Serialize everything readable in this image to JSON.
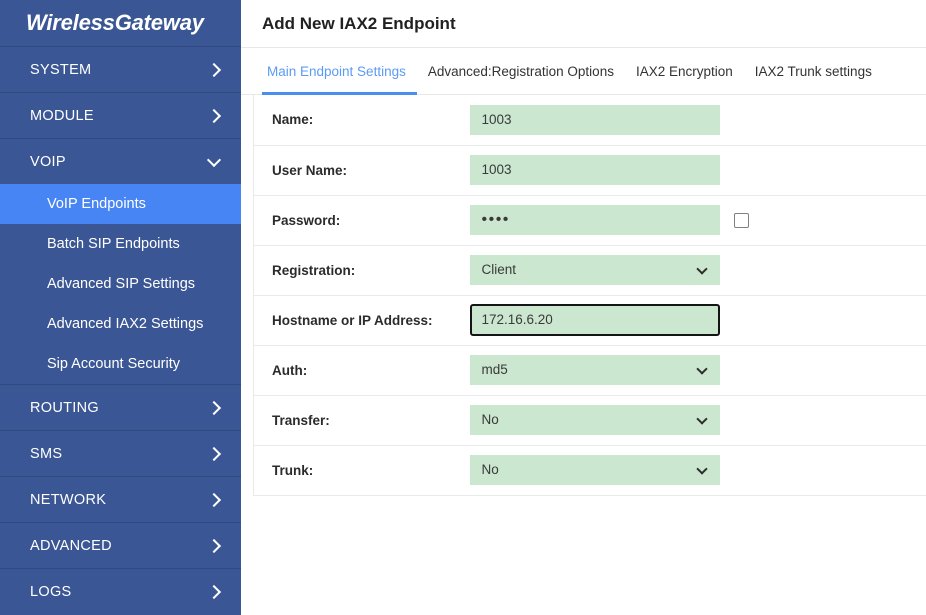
{
  "brand": {
    "name": "WirelessGateway"
  },
  "sidebar": {
    "items": [
      {
        "label": "SYSTEM",
        "icon": "chevron-right-icon",
        "expanded": false
      },
      {
        "label": "MODULE",
        "icon": "chevron-right-icon",
        "expanded": false
      },
      {
        "label": "VOIP",
        "icon": "chevron-down-icon",
        "expanded": true
      },
      {
        "label": "ROUTING",
        "icon": "chevron-right-icon",
        "expanded": false
      },
      {
        "label": "SMS",
        "icon": "chevron-right-icon",
        "expanded": false
      },
      {
        "label": "NETWORK",
        "icon": "chevron-right-icon",
        "expanded": false
      },
      {
        "label": "ADVANCED",
        "icon": "chevron-right-icon",
        "expanded": false
      },
      {
        "label": "LOGS",
        "icon": "chevron-right-icon",
        "expanded": false
      }
    ],
    "voip_submenu": [
      {
        "label": "VoIP Endpoints",
        "active": true
      },
      {
        "label": "Batch SIP Endpoints",
        "active": false
      },
      {
        "label": "Advanced SIP Settings",
        "active": false
      },
      {
        "label": "Advanced IAX2 Settings",
        "active": false
      },
      {
        "label": "Sip Account Security",
        "active": false
      }
    ]
  },
  "page": {
    "title": "Add New IAX2 Endpoint",
    "tabs": [
      {
        "label": "Main Endpoint Settings",
        "active": true
      },
      {
        "label": "Advanced:Registration Options",
        "active": false
      },
      {
        "label": "IAX2 Encryption",
        "active": false
      },
      {
        "label": "IAX2 Trunk settings",
        "active": false
      }
    ]
  },
  "form": {
    "rows": [
      {
        "label": "Name:",
        "type": "text",
        "value": "1003"
      },
      {
        "label": "User Name:",
        "type": "text",
        "value": "1003"
      },
      {
        "label": "Password:",
        "type": "password",
        "value": "••••",
        "checkbox": true,
        "checked": false
      },
      {
        "label": "Registration:",
        "type": "select",
        "value": "Client"
      },
      {
        "label": "Hostname or IP Address:",
        "type": "text",
        "value": "172.16.6.20",
        "focused": true
      },
      {
        "label": "Auth:",
        "type": "select",
        "value": "md5"
      },
      {
        "label": "Transfer:",
        "type": "select",
        "value": "No"
      },
      {
        "label": "Trunk:",
        "type": "select",
        "value": "No"
      }
    ]
  },
  "colors": {
    "sidebar_bg": "#3a5694",
    "sidebar_active": "#4785f4",
    "field_bg": "#cbe7cf",
    "tab_active": "#5b9bf5",
    "tab_underline": "#4a8ef0"
  }
}
